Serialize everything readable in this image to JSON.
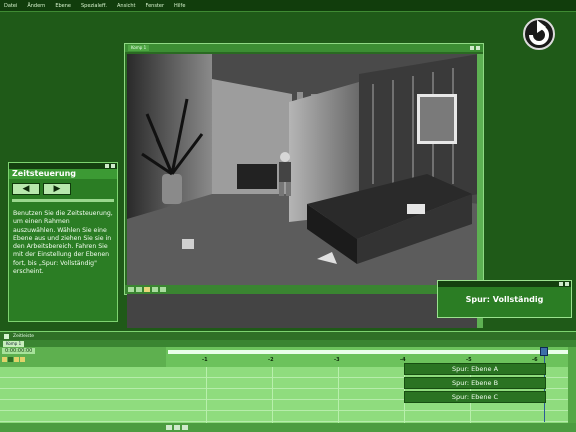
{
  "menu": {
    "items": [
      "Datei",
      "Ändern",
      "Ebene",
      "Spezialeff.",
      "Ansicht",
      "Fenster",
      "Hilfe"
    ]
  },
  "composition": {
    "title": "Komp 1"
  },
  "zeit_panel": {
    "title": "Zeitsteuerung",
    "prev_icon": "◀",
    "next_icon": "▶",
    "instructions": "Benutzen Sie die Zeitsteuerung, um einen Rahmen auszuwählen. Wählen Sie eine Ebene aus und ziehen Sie sie in den Arbeitsbereich. Fahren Sie mit der Einstellung der Ebenen fort, bis „Spur: Vollständig\" erscheint."
  },
  "spur_panel": {
    "status": "Spur: Vollständig"
  },
  "timeline": {
    "title": "Zeitleiste",
    "tab": "Komp 1",
    "timecode": "0:00:00:00",
    "tick_labels": [
      "-1",
      "-2",
      "-3",
      "-4",
      "-5",
      "-6"
    ],
    "layers": [
      "Spur: Ebene A",
      "Spur: Ebene B",
      "Spur: Ebene C"
    ]
  },
  "colors": {
    "background": "#1f5a18",
    "panel": "#2b7d24",
    "timeline": "#8fdc7e",
    "accent": "#3d6fa8"
  },
  "icons": {
    "logo": "refresh-arrow-icon"
  }
}
